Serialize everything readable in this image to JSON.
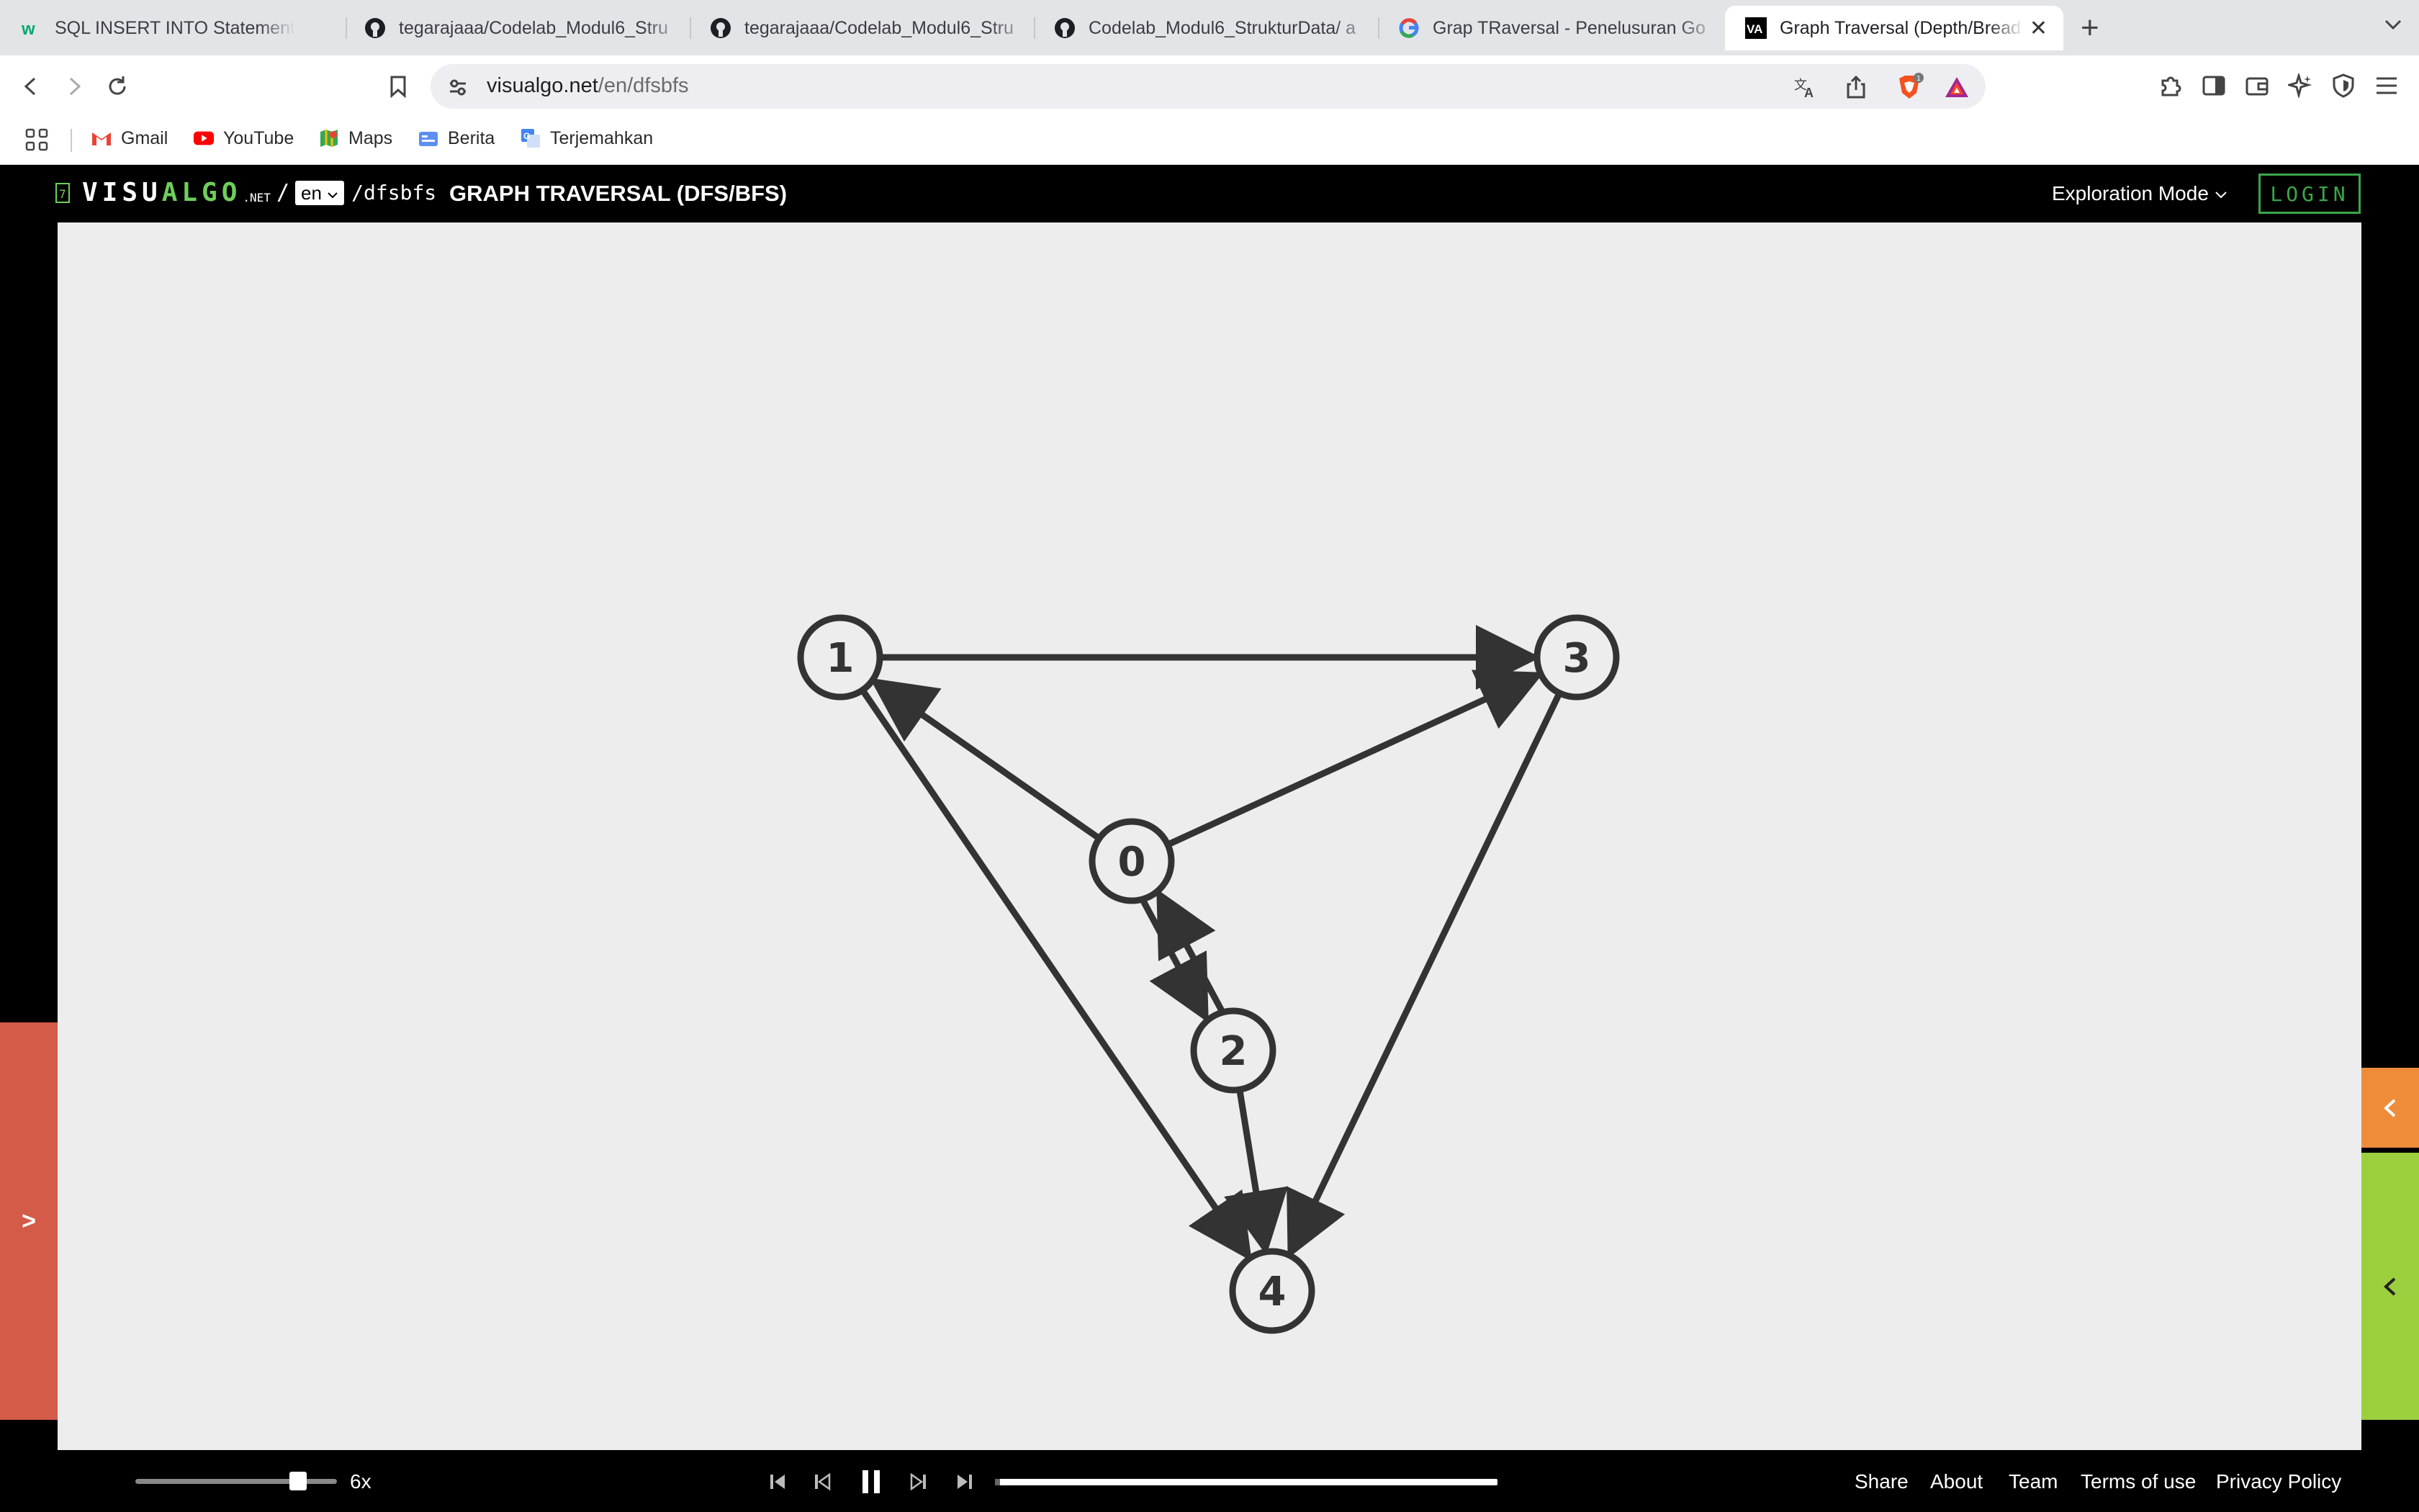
{
  "browser": {
    "tabs": [
      {
        "title": "SQL INSERT INTO Statement",
        "icon": "w3schools-icon"
      },
      {
        "title": "tegarajaaa/Codelab_Modul6_Stru",
        "icon": "github-icon"
      },
      {
        "title": "tegarajaaa/Codelab_Modul6_Stru",
        "icon": "github-icon"
      },
      {
        "title": "Codelab_Modul6_StrukturData/ a",
        "icon": "github-icon"
      },
      {
        "title": "Grap TRaversal - Penelusuran Go",
        "icon": "google-icon"
      },
      {
        "title": "Graph Traversal (Depth/Bread",
        "icon": "visualgo-icon",
        "active": true
      }
    ],
    "url_host": "visualgo.net",
    "url_path": "/en/dfsbfs",
    "brave_badge": "1",
    "bookmarks": [
      {
        "label": "Gmail",
        "icon": "gmail-icon"
      },
      {
        "label": "YouTube",
        "icon": "youtube-icon"
      },
      {
        "label": "Maps",
        "icon": "maps-icon"
      },
      {
        "label": "Berita",
        "icon": "news-icon"
      },
      {
        "label": "Terjemahkan",
        "icon": "translate-icon"
      }
    ]
  },
  "header": {
    "logo_visu": "VISU",
    "logo_algo": "ALGO",
    "logo_net": ".NET",
    "language": "en",
    "path": "/dfsbfs",
    "title": "GRAPH TRAVERSAL (DFS/BFS)",
    "mode": "Exploration Mode",
    "login": "LOGIN"
  },
  "graph": {
    "vertices": [
      {
        "id": "0",
        "label": "0"
      },
      {
        "id": "1",
        "label": "1"
      },
      {
        "id": "2",
        "label": "2"
      },
      {
        "id": "3",
        "label": "3"
      },
      {
        "id": "4",
        "label": "4"
      }
    ],
    "edges": [
      {
        "from": "1",
        "to": "3"
      },
      {
        "from": "0",
        "to": "1"
      },
      {
        "from": "0",
        "to": "3"
      },
      {
        "from": "0",
        "to": "2"
      },
      {
        "from": "2",
        "to": "0"
      },
      {
        "from": "1",
        "to": "4"
      },
      {
        "from": "2",
        "to": "4"
      },
      {
        "from": "3",
        "to": "4"
      }
    ]
  },
  "side_panels": {
    "left_toggle": ">",
    "right_top_toggle": "<",
    "right_bottom_toggle": "<"
  },
  "footer": {
    "speed": "6x",
    "speed_level": 0.75,
    "progress": 0.01,
    "links": [
      "Share",
      "About",
      "Team",
      "Terms of use",
      "Privacy Policy"
    ]
  },
  "colors": {
    "canvas_bg": "#ededed",
    "vertex_stroke": "#333333",
    "login_green": "#3aa64a",
    "left_panel": "#d35b48",
    "right_top_panel": "#ef8c3a",
    "right_bottom_panel": "#9ccf3e"
  }
}
